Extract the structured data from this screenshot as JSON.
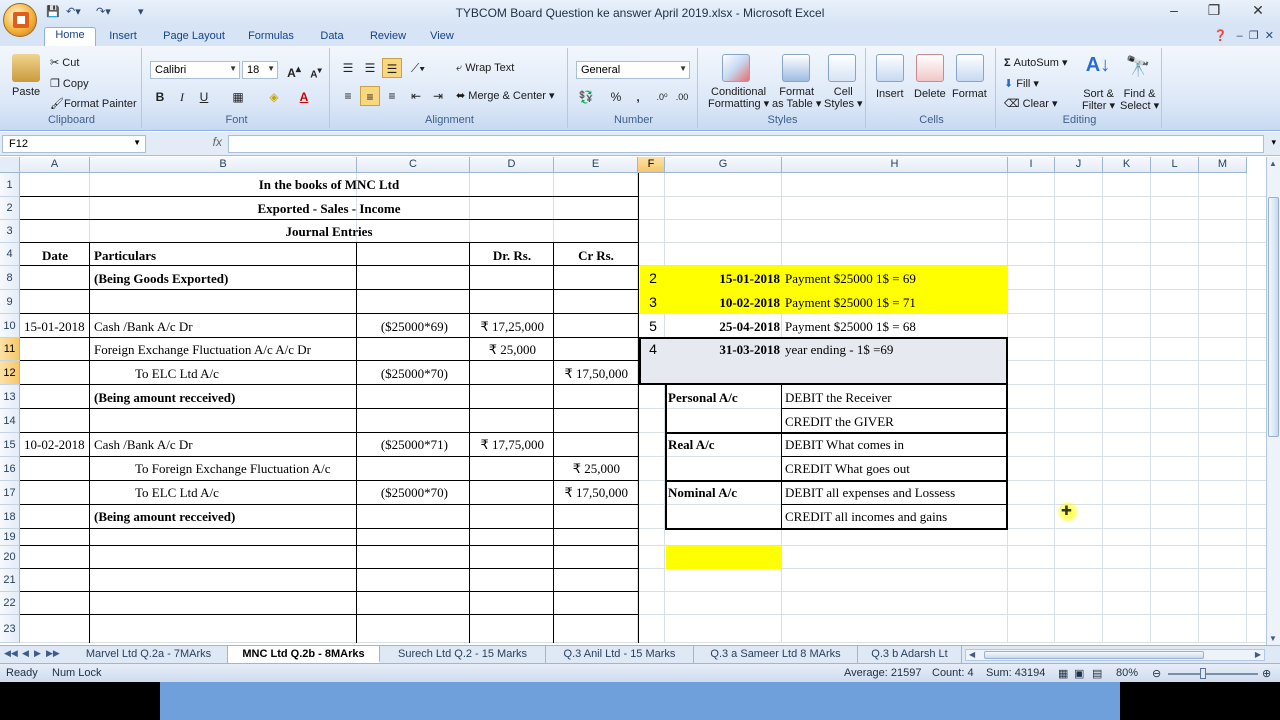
{
  "window": {
    "title": "TYBCOM Board  Question ke answer April 2019.xlsx - Microsoft Excel"
  },
  "ribbon_tabs": [
    "Home",
    "Insert",
    "Page Layout",
    "Formulas",
    "Data",
    "Review",
    "View"
  ],
  "ribbon": {
    "clipboard": {
      "paste": "Paste",
      "cut": "Cut",
      "copy": "Copy",
      "format_painter": "Format Painter",
      "label": "Clipboard"
    },
    "font": {
      "name": "Calibri",
      "size": "18",
      "label": "Font",
      "bold": "B",
      "italic": "I",
      "underline": "U"
    },
    "alignment": {
      "wrap_text": "Wrap Text",
      "merge_center": "Merge & Center",
      "label": "Alignment"
    },
    "number": {
      "format": "General",
      "percent": "%",
      "comma": ",",
      "label": "Number"
    },
    "styles": {
      "conditional": "Conditional",
      "conditional2": "Formatting",
      "format_as": "Format",
      "format_as2": "as Table",
      "cell": "Cell",
      "cell2": "Styles",
      "label": "Styles"
    },
    "cells": {
      "insert": "Insert",
      "delete": "Delete",
      "format": "Format",
      "label": "Cells"
    },
    "editing": {
      "autosum": "AutoSum",
      "fill": "Fill",
      "clear": "Clear",
      "sort": "Sort &",
      "sort2": "Filter",
      "find": "Find &",
      "find2": "Select",
      "label": "Editing"
    }
  },
  "formula_bar": {
    "name_box": "F12",
    "fx": "fx",
    "value": ""
  },
  "columns": [
    "A",
    "B",
    "C",
    "D",
    "E",
    "F",
    "G",
    "H",
    "I",
    "J",
    "K",
    "L",
    "M"
  ],
  "rows": [
    "1",
    "2",
    "3",
    "4",
    "8",
    "9",
    "10",
    "11",
    "12",
    "13",
    "14",
    "15",
    "16",
    "17",
    "18",
    "19",
    "20",
    "21",
    "22",
    "23"
  ],
  "cells": {
    "r1_title": "In the books of MNC Ltd",
    "r2_title": "Exported - Sales - Income",
    "r3_title": "Journal Entries",
    "r4_a": "Date",
    "r4_b": "Particulars",
    "r4_d": "Dr. Rs.",
    "r4_e": "Cr Rs.",
    "r8_b": "(Being Goods Exported)",
    "r8_f": "2",
    "r8_g": "15-01-2018",
    "r8_h": "Payment  $25000 1$ = 69",
    "r9_f": "3",
    "r9_g": "10-02-2018",
    "r9_h": "Payment  $25000 1$ = 71",
    "r10_a": "15-01-2018",
    "r10_b": "Cash /Bank A/c Dr",
    "r10_c": "($25000*69)",
    "r10_d": "₹ 17,25,000",
    "r10_f": "5",
    "r10_g": "25-04-2018",
    "r10_h": "Payment  $25000 1$ = 68",
    "r11_b": "Foreign Exchange Fluctuation A/c A/c Dr",
    "r11_d": "₹ 25,000",
    "r11_f": "4",
    "r11_g": "31-03-2018",
    "r11_h": "year ending - 1$ =69",
    "r12_b": "To ELC Ltd A/c",
    "r12_c": "($25000*70)",
    "r12_e": "₹ 17,50,000",
    "r13_b": "(Being amount recceived)",
    "r13_g": "Personal A/c",
    "r13_h": "DEBIT the Receiver",
    "r14_h": "CREDIT the GIVER",
    "r15_a": "10-02-2018",
    "r15_b": "Cash /Bank A/c Dr",
    "r15_c": "($25000*71)",
    "r15_d": "₹ 17,75,000",
    "r15_g": "Real A/c",
    "r15_h": "DEBIT What comes in",
    "r16_b": "To Foreign Exchange Fluctuation A/c",
    "r16_e": "₹ 25,000",
    "r16_h": "CREDIT What goes out",
    "r17_b": "To ELC Ltd A/c",
    "r17_c": "($25000*70)",
    "r17_e": "₹ 17,50,000",
    "r17_g": "Nominal A/c",
    "r17_h": "DEBIT all expenses and Lossess",
    "r18_b": "(Being amount recceived)",
    "r18_h": "CREDIT all incomes and gains"
  },
  "sheet_tabs": [
    "Marvel Ltd Q.2a - 7MArks",
    "MNC Ltd Q.2b - 8MArks",
    "Surech Ltd Q.2 - 15 Marks",
    "Q.3 Anil Ltd - 15 Marks",
    "Q.3 a Sameer Ltd 8 MArks",
    "Q.3 b Adarsh Lt"
  ],
  "status": {
    "ready": "Ready",
    "num_lock": "Num Lock",
    "average": "Average: 21597",
    "count": "Count: 4",
    "sum": "Sum: 43194",
    "zoom": "80%"
  },
  "colors": {
    "highlight": "#ffff00",
    "accent": "#15428b"
  }
}
